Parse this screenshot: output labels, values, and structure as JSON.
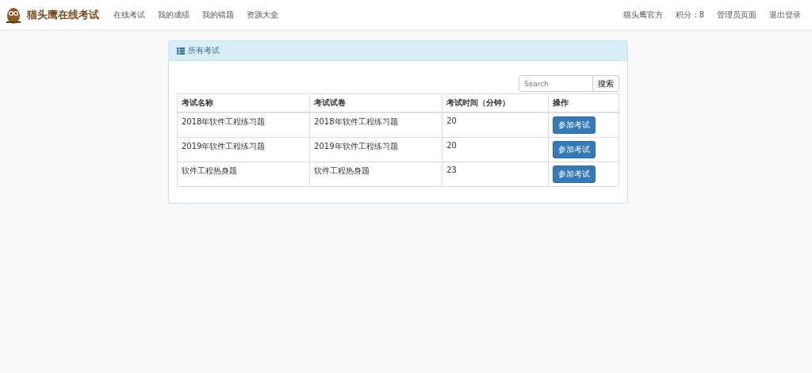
{
  "navbar": {
    "brand": "猫头鹰在线考试",
    "links": [
      "在线考试",
      "我的成绩",
      "我的错题",
      "资源大全"
    ],
    "right_links": [
      "猫头鹰官方",
      "积分：8",
      "管理员页面",
      "退出登录"
    ]
  },
  "panel": {
    "title": "所有考试",
    "search": {
      "placeholder": "Search",
      "button": "搜索"
    },
    "table": {
      "columns": [
        "考试名称",
        "考试试卷",
        "考试时间（分钟）",
        "操作"
      ],
      "rows": [
        {
          "name": "2018年软件工程练习题",
          "paper": "2018年软件工程练习题",
          "minutes": "20",
          "action": "参加考试"
        },
        {
          "name": "2019年软件工程练习题",
          "paper": "2019年软件工程练习题",
          "minutes": "20",
          "action": "参加考试"
        },
        {
          "name": "软件工程热身题",
          "paper": "软件工程热身题",
          "minutes": "23",
          "action": "参加考试"
        }
      ]
    }
  }
}
